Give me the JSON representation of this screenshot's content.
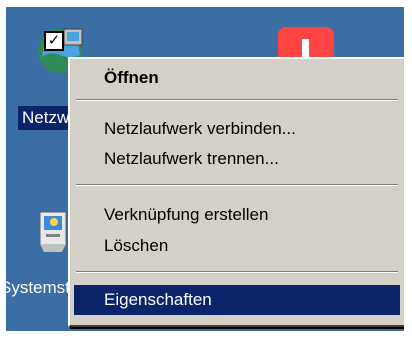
{
  "desktop": {
    "icons": {
      "network_label": "Netzwerkumgebung",
      "system_label": "Systemsteuerung"
    }
  },
  "context_menu": {
    "items": [
      {
        "label": "Öffnen",
        "bold": true,
        "selected": false
      },
      {
        "label": "Netzlaufwerk verbinden...",
        "bold": false,
        "selected": false
      },
      {
        "label": "Netzlaufwerk trennen...",
        "bold": false,
        "selected": false
      },
      {
        "label": "Verknüpfung erstellen",
        "bold": false,
        "selected": false
      },
      {
        "label": "Löschen",
        "bold": false,
        "selected": false
      },
      {
        "label": "Eigenschaften",
        "bold": false,
        "selected": true
      }
    ]
  },
  "colors": {
    "desktop_background": "#3a6ea5",
    "menu_background": "#d4d0c8",
    "selection_highlight": "#0a246a"
  }
}
